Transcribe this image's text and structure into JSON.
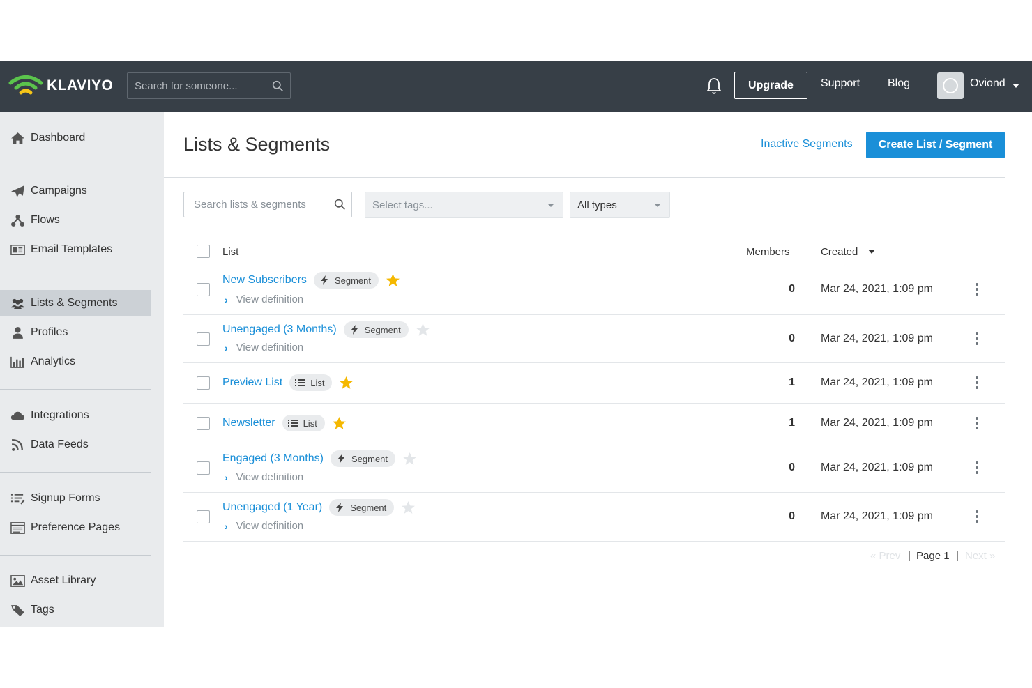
{
  "nav": {
    "brand": "KLAVIYO",
    "search_placeholder": "Search for someone...",
    "upgrade_label": "Upgrade",
    "support_label": "Support",
    "blog_label": "Blog",
    "user_name": "Oviond",
    "brand_colors": {
      "logo_green": "#5bc44c",
      "logo_yellow": "#f5c518",
      "bar": "#373f47"
    }
  },
  "sidebar": {
    "items": [
      {
        "label": "Dashboard",
        "icon": "home-icon"
      },
      {
        "label": "Campaigns",
        "icon": "paper-plane-icon"
      },
      {
        "label": "Flows",
        "icon": "flows-icon"
      },
      {
        "label": "Email Templates",
        "icon": "email-template-icon"
      },
      {
        "label": "Lists & Segments",
        "icon": "users-icon",
        "active": true
      },
      {
        "label": "Profiles",
        "icon": "user-icon"
      },
      {
        "label": "Analytics",
        "icon": "bar-chart-icon"
      },
      {
        "label": "Integrations",
        "icon": "cloud-icon"
      },
      {
        "label": "Data Feeds",
        "icon": "rss-icon"
      },
      {
        "label": "Signup Forms",
        "icon": "form-icon"
      },
      {
        "label": "Preference Pages",
        "icon": "preference-page-icon"
      },
      {
        "label": "Asset Library",
        "icon": "image-icon"
      },
      {
        "label": "Tags",
        "icon": "tag-icon"
      }
    ]
  },
  "main": {
    "title": "Lists & Segments",
    "inactive_link": "Inactive Segments",
    "create_button": "Create List / Segment",
    "filters": {
      "search_placeholder": "Search lists & segments",
      "tags_placeholder": "Select tags...",
      "type_value": "All types"
    },
    "table": {
      "headers": {
        "list": "List",
        "members": "Members",
        "created": "Created"
      },
      "view_definition_label": "View definition",
      "rows": [
        {
          "name": "New Subscribers",
          "type": "Segment",
          "starred": true,
          "members": "0",
          "created": "Mar 24, 2021, 1:09 pm"
        },
        {
          "name": "Unengaged (3 Months)",
          "type": "Segment",
          "starred": false,
          "members": "0",
          "created": "Mar 24, 2021, 1:09 pm"
        },
        {
          "name": "Preview List",
          "type": "List",
          "starred": true,
          "members": "1",
          "created": "Mar 24, 2021, 1:09 pm"
        },
        {
          "name": "Newsletter",
          "type": "List",
          "starred": true,
          "members": "1",
          "created": "Mar 24, 2021, 1:09 pm"
        },
        {
          "name": "Engaged (3 Months)",
          "type": "Segment",
          "starred": false,
          "members": "0",
          "created": "Mar 24, 2021, 1:09 pm"
        },
        {
          "name": "Unengaged (1 Year)",
          "type": "Segment",
          "starred": false,
          "members": "0",
          "created": "Mar 24, 2021, 1:09 pm"
        }
      ]
    },
    "pagination": {
      "prev": "« Prev",
      "separator": "|",
      "page": "Page 1",
      "next": "Next »"
    }
  },
  "colors": {
    "link": "#1a8fd8",
    "star_on": "#f5b800",
    "star_off": "#e3e6e9"
  }
}
